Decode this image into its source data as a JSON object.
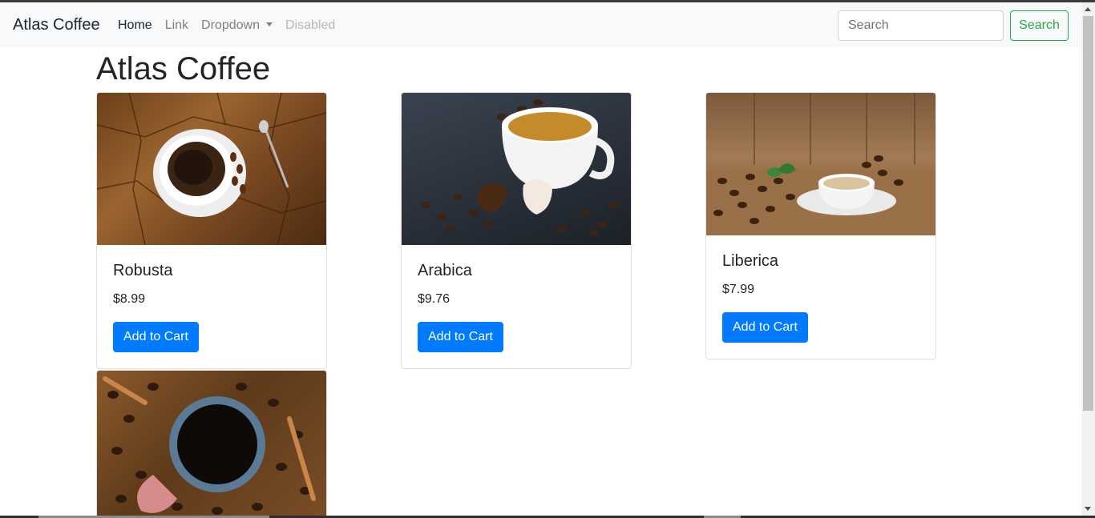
{
  "navbar": {
    "brand": "Atlas Coffee",
    "links": [
      {
        "label": "Home"
      },
      {
        "label": "Link"
      },
      {
        "label": "Dropdown"
      },
      {
        "label": "Disabled"
      }
    ],
    "search": {
      "placeholder": "Search",
      "button_label": "Search"
    }
  },
  "page": {
    "title": "Atlas Coffee"
  },
  "products": [
    {
      "name": "Robusta",
      "price": "$8.99",
      "button_label": "Add to Cart"
    },
    {
      "name": "Arabica",
      "price": "$9.76",
      "button_label": "Add to Cart"
    },
    {
      "name": "Liberica",
      "price": "$7.99",
      "button_label": "Add to Cart"
    }
  ],
  "colors": {
    "primary": "#007bff",
    "success": "#28a745",
    "navbar_bg": "#f8f9fa"
  }
}
